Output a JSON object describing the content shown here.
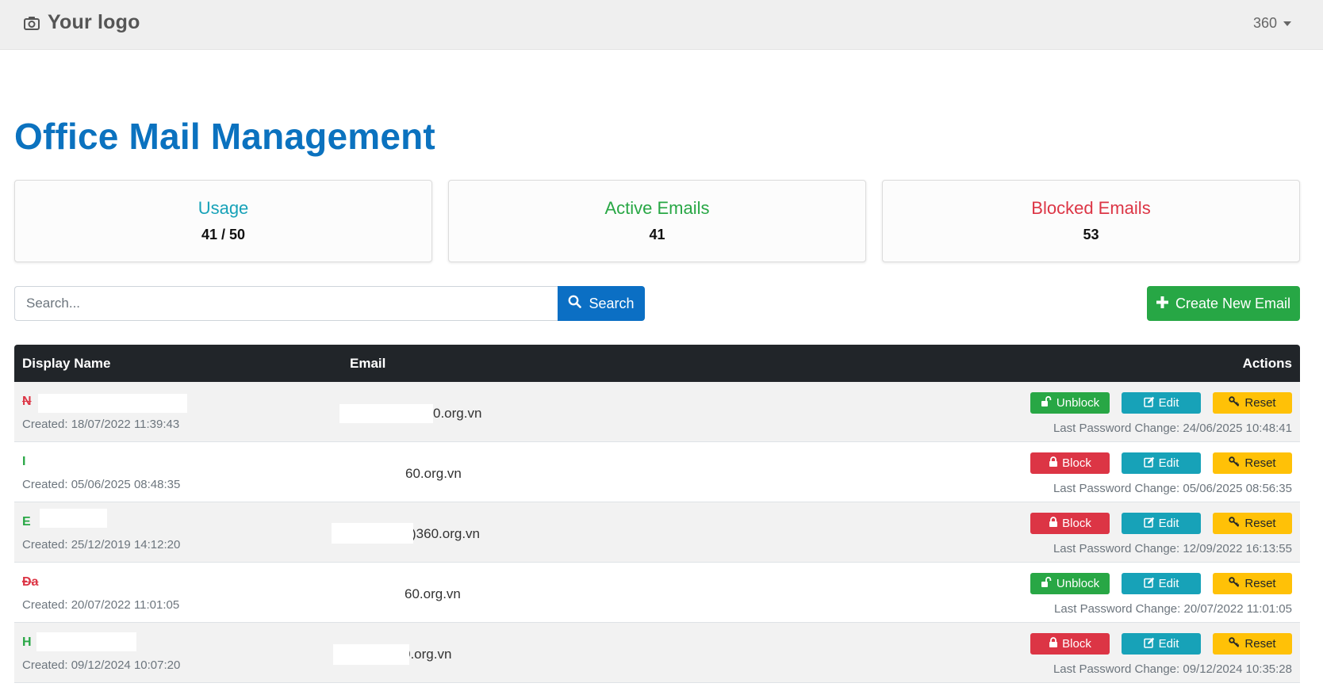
{
  "header": {
    "logo_text": "Your logo",
    "user_menu": "360"
  },
  "page": {
    "title": "Office Mail Management"
  },
  "stats": [
    {
      "label": "Usage",
      "value": "41 / 50",
      "color": "#17a2b8"
    },
    {
      "label": "Active Emails",
      "value": "41",
      "color": "#28a745"
    },
    {
      "label": "Blocked Emails",
      "value": "53",
      "color": "#dc3545"
    }
  ],
  "search": {
    "placeholder": "Search...",
    "button_label": "Search"
  },
  "create_button": {
    "label": "Create New Email"
  },
  "table": {
    "headers": {
      "display_name": "Display Name",
      "email": "Email",
      "actions": "Actions"
    },
    "rows": [
      {
        "name": "N",
        "status": "blocked",
        "created": "Created: 18/07/2022  11:39:43",
        "email": "0.org.vn",
        "toggle_label": "Unblock",
        "edit_label": "Edit",
        "reset_label": "Reset",
        "last_pwd": "Last Password Change: 24/06/2025  10:48:41"
      },
      {
        "name": "I",
        "status": "active",
        "created": "Created: 05/06/2025  08:48:35",
        "email": "60.org.vn",
        "toggle_label": "Block",
        "edit_label": "Edit",
        "reset_label": "Reset",
        "last_pwd": "Last Password Change: 05/06/2025  08:56:35"
      },
      {
        "name": "E",
        "status": "active",
        "created": "Created: 25/12/2019  14:12:20",
        "email": ")360.org.vn",
        "toggle_label": "Block",
        "edit_label": "Edit",
        "reset_label": "Reset",
        "last_pwd": "Last Password Change: 12/09/2022  16:13:55"
      },
      {
        "name": "Đa",
        "status": "blocked",
        "created": "Created: 20/07/2022  11:01:05",
        "email": "60.org.vn",
        "toggle_label": "Unblock",
        "edit_label": "Edit",
        "reset_label": "Reset",
        "last_pwd": "Last Password Change: 20/07/2022  11:01:05"
      },
      {
        "name": "H",
        "status": "active",
        "created": "Created: 09/12/2024  10:07:20",
        "email": "0.org.vn",
        "toggle_label": "Block",
        "edit_label": "Edit",
        "reset_label": "Reset",
        "last_pwd": "Last Password Change: 09/12/2024  10:35:28"
      }
    ]
  },
  "icons": {
    "logo": "camera-icon",
    "search": "search-icon",
    "create": "plus-icon",
    "unblock": "unlock-icon",
    "block": "lock-icon",
    "edit": "edit-icon",
    "reset": "key-icon"
  }
}
